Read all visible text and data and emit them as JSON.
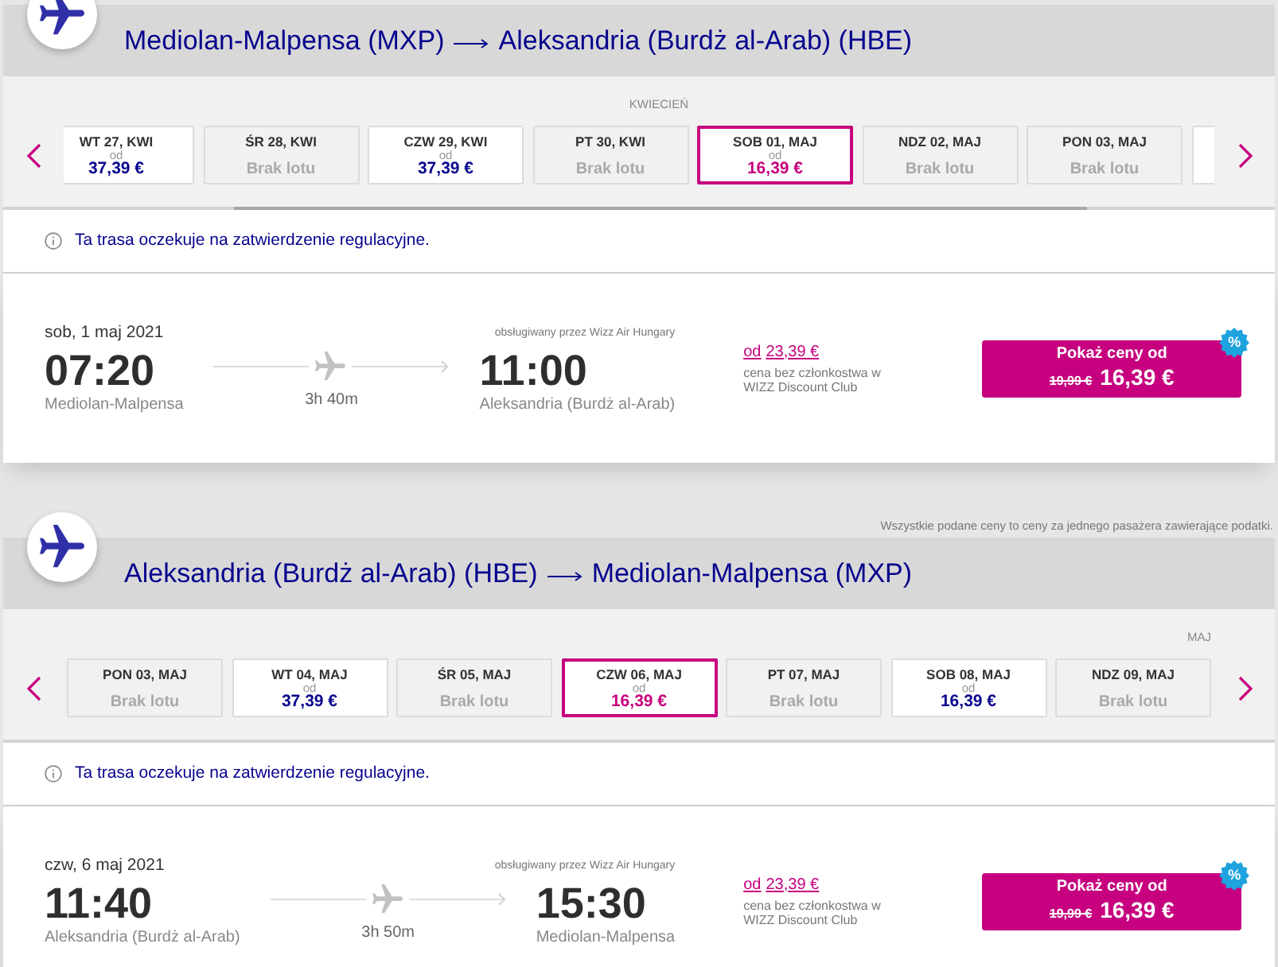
{
  "sections": [
    {
      "header": {
        "origin": "Mediolan-Malpensa (MXP)",
        "destination": "Aleksandria (Burdż al-Arab) (HBE)"
      },
      "date_strip": {
        "scrollbar": true,
        "days": [
          {
            "kind": "flight",
            "label": "WT 27, KWI",
            "from": "od",
            "price": "37,39 €",
            "selected": false
          },
          {
            "kind": "no_flight",
            "label": "ŚR 28, KWI",
            "status": "Brak lotu",
            "selected": false
          },
          {
            "kind": "flight",
            "label": "CZW 29, KWI",
            "from": "od",
            "price": "37,39 €",
            "selected": false
          },
          {
            "kind": "no_flight",
            "month": "KWIECIEŃ",
            "label": "PT 30, KWI",
            "status": "Brak lotu",
            "selected": false
          },
          {
            "kind": "flight",
            "label": "SOB 01, MAJ",
            "from": "od",
            "price": "16,39 €",
            "selected": true
          },
          {
            "kind": "no_flight",
            "label": "NDZ 02, MAJ",
            "status": "Brak lotu",
            "selected": false
          },
          {
            "kind": "no_flight",
            "label": "PON 03, MAJ",
            "status": "Brak lotu",
            "selected": false
          },
          {
            "kind": "flight",
            "selected": false
          }
        ]
      },
      "notice": "Ta trasa oczekuje na zatwierdzenie regulacyjne.",
      "flight": {
        "date": "sob, 1 maj 2021",
        "operator": "obsługiwany przez Wizz Air Hungary",
        "departure_time": "07:20",
        "departure_airport": "Mediolan-Malpensa",
        "duration": "3h 40m",
        "arrival_time": "11:00",
        "arrival_airport": "Aleksandria (Burdż al-Arab)",
        "member_price": {
          "prefix": "od",
          "amount": "23,39 €"
        },
        "member_note": "cena bez członkostwa w WIZZ Discount Club",
        "button": {
          "label": "Pokaż ceny od",
          "old_price": "19,99 €",
          "price": "16,39 €"
        },
        "badge": "%"
      }
    },
    {
      "note": "Wszystkie podane ceny to ceny za jednego pasażera zawierające podatki.",
      "header": {
        "origin": "Aleksandria (Burdż al-Arab) (HBE)",
        "destination": "Mediolan-Malpensa (MXP)"
      },
      "date_strip": {
        "scrollbar": false,
        "days": [
          {
            "kind": "no_flight",
            "label": "PON 03, MAJ",
            "status": "Brak lotu",
            "selected": false
          },
          {
            "kind": "flight",
            "label": "WT 04, MAJ",
            "from": "od",
            "price": "37,39 €",
            "selected": false
          },
          {
            "kind": "no_flight",
            "label": "ŚR 05, MAJ",
            "status": "Brak lotu",
            "selected": false
          },
          {
            "kind": "flight",
            "label": "CZW 06, MAJ",
            "from": "od",
            "price": "16,39 €",
            "selected": true
          },
          {
            "kind": "no_flight",
            "label": "PT 07, MAJ",
            "status": "Brak lotu",
            "selected": false
          },
          {
            "kind": "flight",
            "label": "SOB 08, MAJ",
            "from": "od",
            "price": "16,39 €",
            "selected": false
          },
          {
            "kind": "no_flight",
            "month": "MAJ",
            "label": "NDZ 09, MAJ",
            "status": "Brak lotu",
            "selected": false
          }
        ]
      },
      "notice": "Ta trasa oczekuje na zatwierdzenie regulacyjne.",
      "flight": {
        "date": "czw, 6 maj 2021",
        "operator": "obsługiwany przez Wizz Air Hungary",
        "departure_time": "11:40",
        "departure_airport": "Aleksandria (Burdż al-Arab)",
        "duration": "3h 50m",
        "arrival_time": "15:30",
        "arrival_airport": "Mediolan-Malpensa",
        "member_price": {
          "prefix": "od",
          "amount": "23,39 €"
        },
        "member_note": "cena bez członkostwa w WIZZ Discount Club",
        "button": {
          "label": "Pokaż ceny od",
          "old_price": "19,99 €",
          "price": "16,39 €"
        },
        "badge": "%"
      }
    }
  ]
}
